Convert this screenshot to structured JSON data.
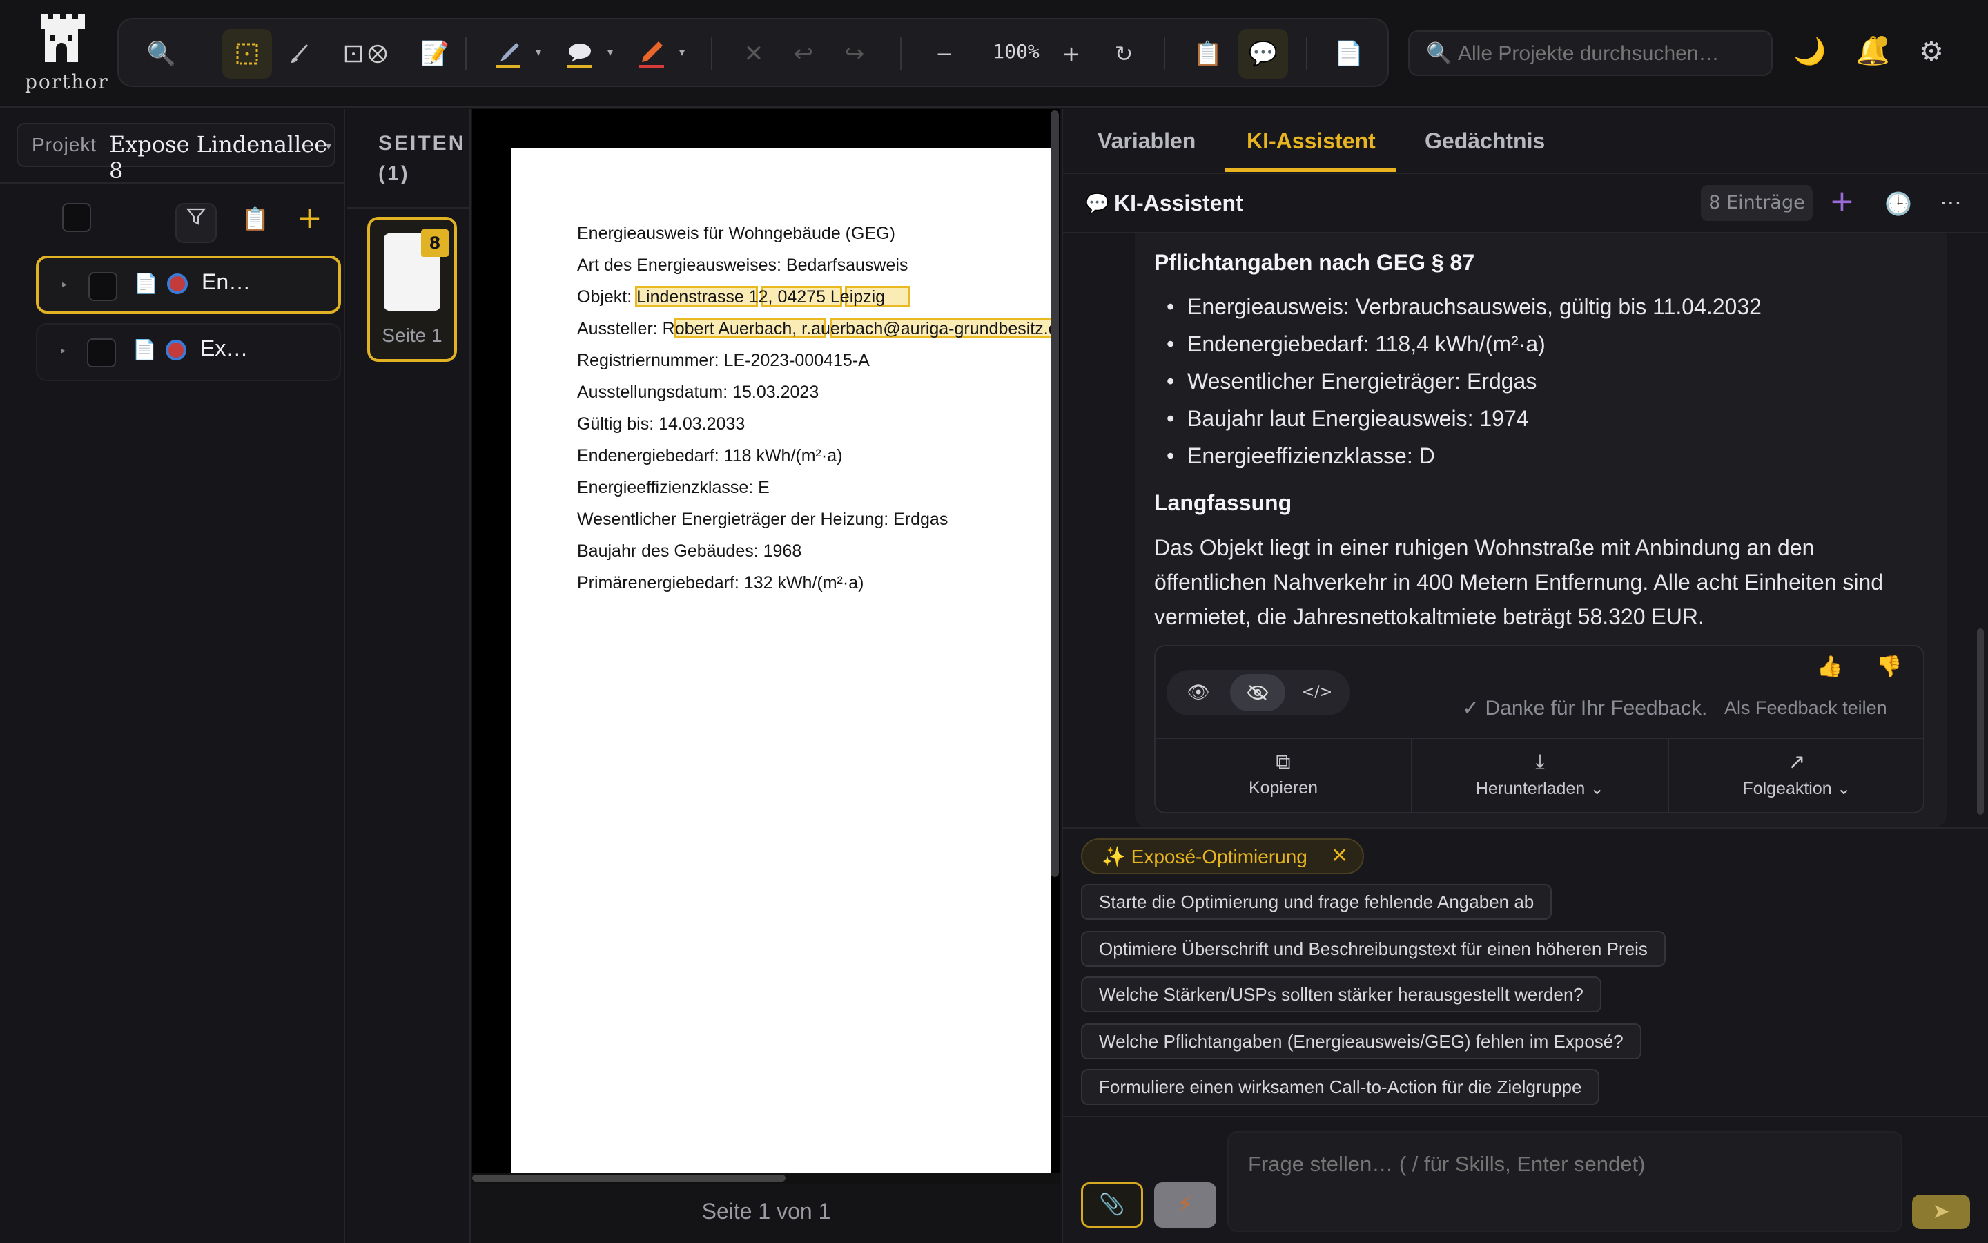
{
  "app": {
    "logo_text": "porthor"
  },
  "toolbar": {
    "zoom": "100%",
    "search_placeholder": "Alle Projekte durchsuchen…"
  },
  "sidebar": {
    "project_label": "Projekt",
    "project_name": "Expose Lindenallee 8",
    "files": [
      {
        "name": "En…",
        "selected": true
      },
      {
        "name": "Ex…",
        "selected": false
      }
    ]
  },
  "pages": {
    "title_line1": "SEITEN",
    "title_line2": "(1)",
    "thumb_badge": "8",
    "thumb_label": "Seite 1",
    "footer": "Seite 1 von 1"
  },
  "document": {
    "lines": [
      "Energieausweis für Wohngebäude (GEG)",
      "Art des Energieausweises: Bedarfsausweis",
      "Objekt: Lindenstrasse 12, 04275 Leipzig",
      "Aussteller: Robert Auerbach, r.auerbach@auriga-grundbesitz.de",
      "Registriernummer: LE-2023-000415-A",
      "Ausstellungsdatum: 15.03.2023",
      "Gültig bis: 14.03.2033",
      "Endenergiebedarf: 118 kWh/(m²·a)",
      "Energieeffizienzklasse: E",
      "Wesentlicher Energieträger der Heizung: Erdgas",
      "Baujahr des Gebäudes: 1968",
      "Primärenergiebedarf: 132 kWh/(m²·a)"
    ]
  },
  "right": {
    "tabs": [
      "Variablen",
      "KI-Assistent",
      "Gedächtnis"
    ],
    "active_tab": "KI-Assistent",
    "header_title": "KI-Assistent",
    "entries": "8 Einträge",
    "message": {
      "h1": "Pflichtangaben nach GEG § 87",
      "bullets": [
        "Energieausweis: Verbrauchsausweis, gültig bis 11.04.2032",
        "Endenergiebedarf: 118,4 kWh/(m²·a)",
        "Wesentlicher Energieträger: Erdgas",
        "Baujahr laut Energieausweis: 1974",
        "Energieeffizienzklasse: D"
      ],
      "h2": "Langfassung",
      "paragraph": "Das Objekt liegt in einer ruhigen Wohnstraße mit Anbindung an den öffentlichen Nahverkehr in 400 Metern Entfernung. Alle acht Einheiten sind vermietet, die Jahresnettokaltmiete beträgt 58.320 EUR."
    },
    "feedback_thanks": "✓ Danke für Ihr Feedback.",
    "feedback_share": "Als Feedback teilen",
    "actions": {
      "copy": "Kopieren",
      "download": "Herunterladen",
      "follow": "Folgeaktion"
    },
    "skill_chip": "✨ Exposé-Optimierung",
    "suggestions": [
      "Starte die Optimierung und frage fehlende Angaben ab",
      "Optimiere Überschrift und Beschreibungstext für einen höheren Preis",
      "Welche Stärken/USPs sollten stärker herausgestellt werden?",
      "Welche Pflichtangaben (Energieausweis/GEG) fehlen im Exposé?",
      "Formuliere einen wirksamen Call-to-Action für die Zielgruppe"
    ],
    "input_placeholder": "Frage stellen… ( / für Skills, Enter sendet)"
  },
  "colors": {
    "accent": "#e8b520",
    "background": "#141416",
    "panel": "#18181c"
  }
}
